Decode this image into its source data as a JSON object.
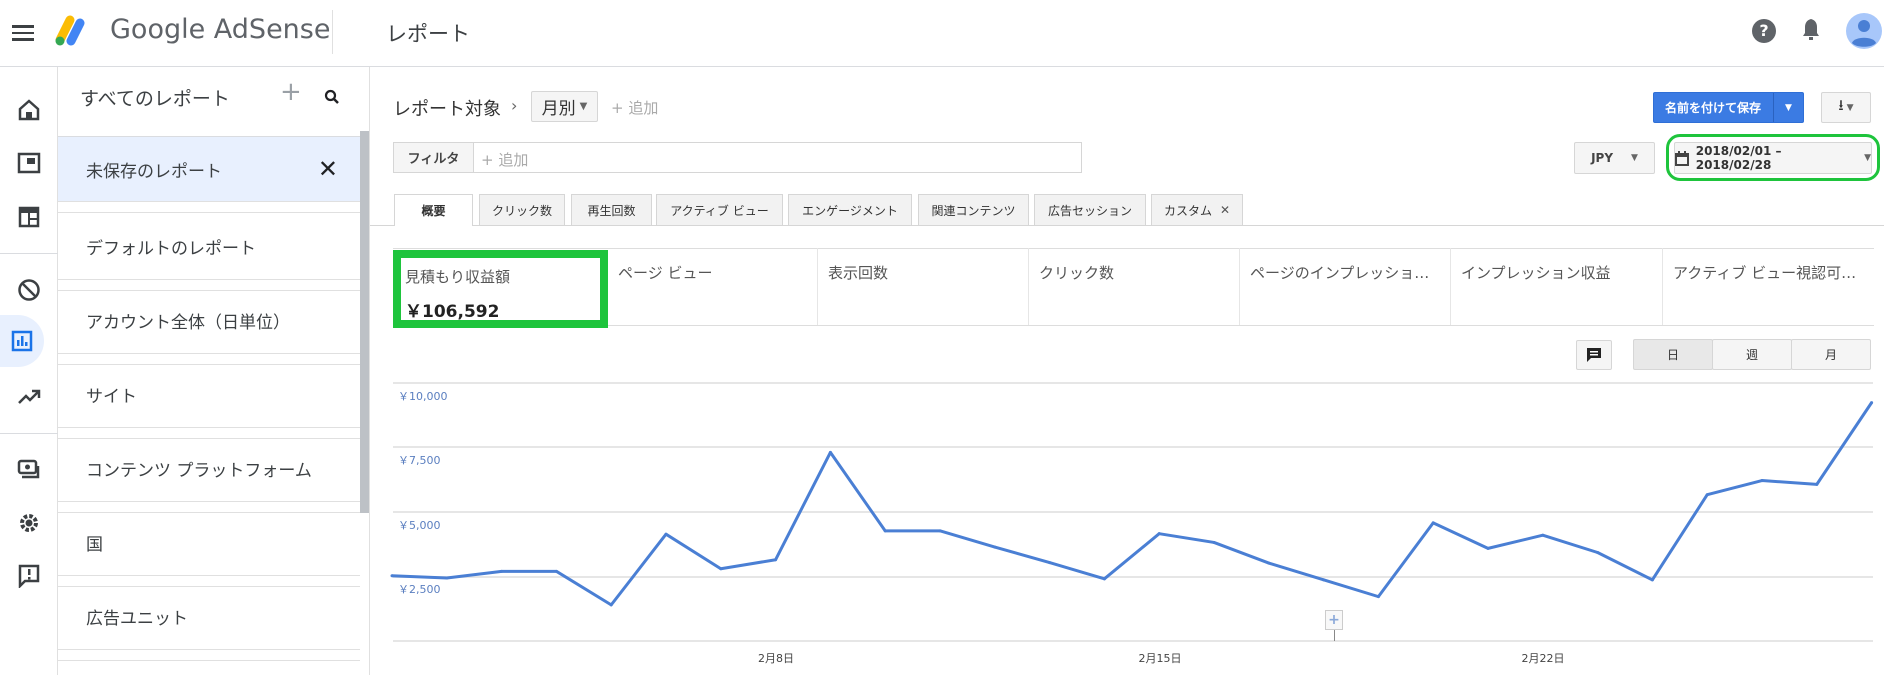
{
  "header": {
    "app_name": "Google AdSense",
    "page_title": "レポート",
    "icons": [
      "menu-icon",
      "help-icon",
      "bell-icon",
      "avatar-icon"
    ]
  },
  "rail": {
    "icons": [
      "home-icon",
      "ads-icon",
      "layout-icon",
      "block-icon",
      "reports-icon",
      "optimization-icon",
      "payments-icon",
      "settings-icon",
      "feedback-icon"
    ],
    "active": "reports-icon"
  },
  "sidebar": {
    "title": "すべてのレポート",
    "items": [
      {
        "label": "未保存のレポート",
        "selected": true
      },
      {
        "label": "デフォルトのレポート"
      },
      {
        "label": "アカウント全体（日単位）"
      },
      {
        "label": "サイト"
      },
      {
        "label": "コンテンツ プラットフォーム"
      },
      {
        "label": "国"
      },
      {
        "label": "広告ユニット"
      }
    ]
  },
  "report": {
    "breadcrumb_label": "レポート対象",
    "dimension": "月別",
    "add_label": "+ 追加",
    "filter_label": "フィルタ",
    "filter_placeholder": "+ 追加",
    "save_label": "名前を付けて保存",
    "currency": "JPY",
    "date_range": "2018/02/01 – 2018/02/28"
  },
  "tabs": [
    {
      "label": "概要",
      "active": true
    },
    {
      "label": "クリック数"
    },
    {
      "label": "再生回数"
    },
    {
      "label": "アクティブ ビュー"
    },
    {
      "label": "エンゲージメント"
    },
    {
      "label": "関連コンテンツ"
    },
    {
      "label": "広告セッション"
    },
    {
      "label": "カスタム",
      "closable": true
    }
  ],
  "metrics": [
    {
      "label": "見積もり収益額",
      "value": "￥106,592",
      "selected": true
    },
    {
      "label": "ページ ビュー"
    },
    {
      "label": "表示回数"
    },
    {
      "label": "クリック数"
    },
    {
      "label": "ページのインプレッション..."
    },
    {
      "label": "インプレッション収益"
    },
    {
      "label": "アクティブ ビュー視認可能..."
    }
  ],
  "granularity": {
    "options": [
      "日",
      "週",
      "月"
    ],
    "selected": "日"
  },
  "highlight_color": "#1ec43c",
  "chart_data": {
    "type": "line",
    "x": [
      "2018-02-01",
      "2018-02-02",
      "2018-02-03",
      "2018-02-04",
      "2018-02-05",
      "2018-02-06",
      "2018-02-07",
      "2018-02-08",
      "2018-02-09",
      "2018-02-10",
      "2018-02-11",
      "2018-02-12",
      "2018-02-13",
      "2018-02-14",
      "2018-02-15",
      "2018-02-16",
      "2018-02-17",
      "2018-02-18",
      "2018-02-19",
      "2018-02-20",
      "2018-02-21",
      "2018-02-22",
      "2018-02-23",
      "2018-02-24",
      "2018-02-25",
      "2018-02-26",
      "2018-02-27",
      "2018-02-28"
    ],
    "values": [
      2530,
      2440,
      2700,
      2700,
      1400,
      4140,
      2800,
      3150,
      7310,
      4270,
      4270,
      3640,
      3040,
      2410,
      4160,
      3820,
      3020,
      2370,
      1720,
      4580,
      3590,
      4100,
      3430,
      2370,
      5670,
      6220,
      6070,
      9240
    ],
    "ylim": [
      0,
      10000
    ],
    "yticks": [
      "￥2,500",
      "￥5,000",
      "￥7,500",
      "￥10,000"
    ],
    "ytick_values": [
      2500,
      5000,
      7500,
      10000
    ],
    "xticks": [
      {
        "date": "2018-02-08",
        "label": "2月8日"
      },
      {
        "date": "2018-02-15",
        "label": "2月15日"
      },
      {
        "date": "2018-02-22",
        "label": "2月22日"
      }
    ],
    "color": "#4a7fd4",
    "grid": true
  }
}
